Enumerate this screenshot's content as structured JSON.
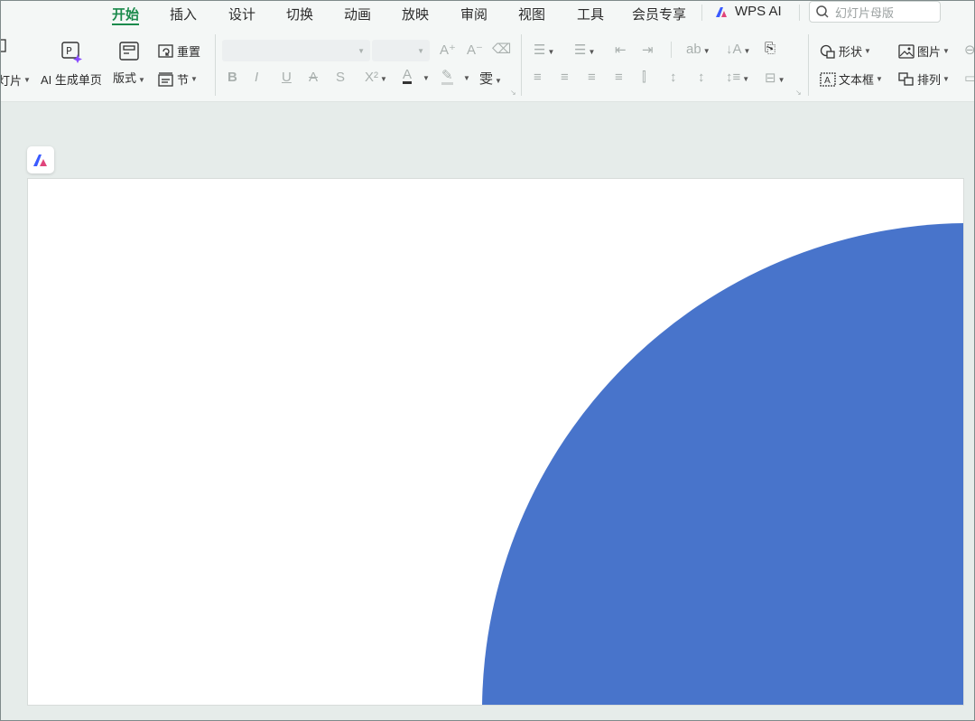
{
  "menu": {
    "tabs": [
      {
        "label": "开始",
        "active": true
      },
      {
        "label": "插入"
      },
      {
        "label": "设计"
      },
      {
        "label": "切换"
      },
      {
        "label": "动画"
      },
      {
        "label": "放映"
      },
      {
        "label": "审阅"
      },
      {
        "label": "视图"
      },
      {
        "label": "工具"
      },
      {
        "label": "会员专享"
      }
    ],
    "wps_ai": "WPS AI",
    "search_placeholder": "幻灯片母版"
  },
  "toolbar": {
    "new_slide": "灯片",
    "ai_generate": "AI 生成单页",
    "layout": "版式",
    "reset": "重置",
    "section": "节",
    "shape": "形状",
    "picture": "图片",
    "textbox": "文本框",
    "arrange": "排列"
  },
  "colors": {
    "accent": "#1b8a4c",
    "shape_fill": "#4874cb",
    "ai_purple": "#8a4dff"
  },
  "icons": [
    "new-slide-icon",
    "ai-generate-icon",
    "layout-icon",
    "reset-icon",
    "section-icon",
    "bold-icon",
    "italic-icon",
    "underline-icon",
    "strikethrough-icon",
    "superscript-icon",
    "font-color-icon",
    "highlight-icon",
    "pinyin-icon",
    "bullets-icon",
    "numbering-icon",
    "shape-icon",
    "picture-icon",
    "textbox-icon",
    "arrange-icon",
    "search-icon",
    "wps-ai-icon"
  ]
}
